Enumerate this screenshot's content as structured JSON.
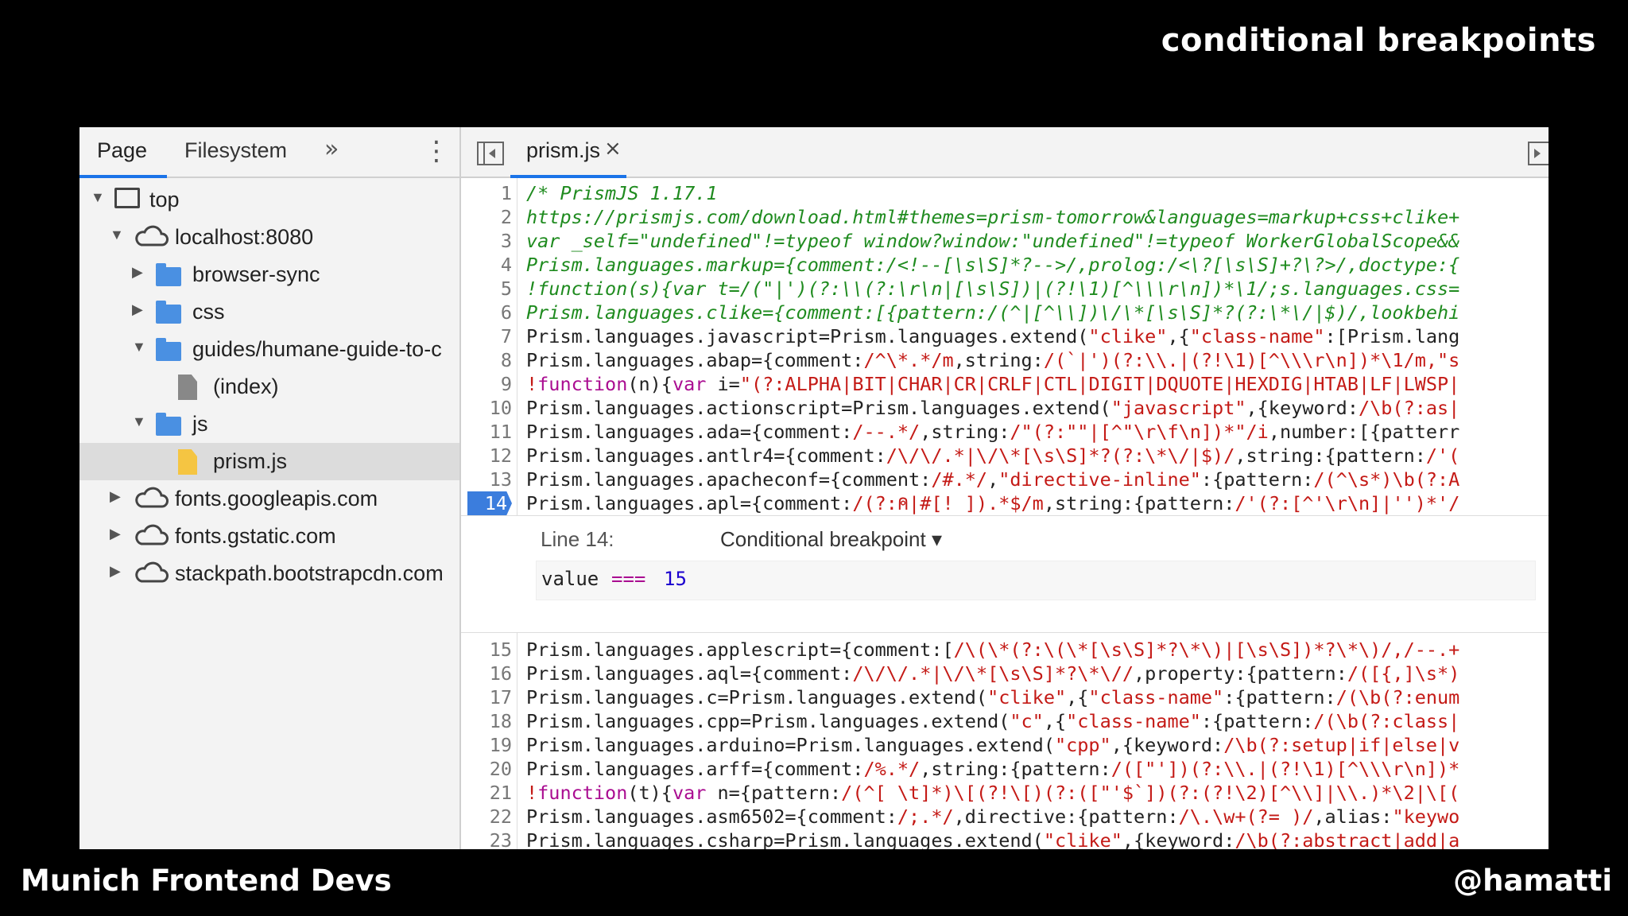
{
  "slide": {
    "title": "conditional breakpoints",
    "footer_left": "Munich Frontend Devs",
    "footer_right": "@hamatti"
  },
  "navigator": {
    "tabs": [
      "Page",
      "Filesystem"
    ],
    "more": "»",
    "menu": "⋮",
    "tree": [
      {
        "label": "top",
        "icon": "frame-icon",
        "arrow": "▼",
        "indent": 0
      },
      {
        "label": "localhost:8080",
        "icon": "cloud-icon",
        "arrow": "▼",
        "indent": 1
      },
      {
        "label": "browser-sync",
        "icon": "folder-icon",
        "arrow": "▶",
        "indent": 2
      },
      {
        "label": "css",
        "icon": "folder-icon",
        "arrow": "▶",
        "indent": 2
      },
      {
        "label": "guides/humane-guide-to-c",
        "icon": "folder-icon",
        "arrow": "▼",
        "indent": 2
      },
      {
        "label": "(index)",
        "icon": "file-icon",
        "arrow": "",
        "indent": 3
      },
      {
        "label": "js",
        "icon": "folder-icon",
        "arrow": "▼",
        "indent": 2
      },
      {
        "label": "prism.js",
        "icon": "js-file-icon",
        "arrow": "",
        "indent": 3
      },
      {
        "label": "fonts.googleapis.com",
        "icon": "cloud-icon",
        "arrow": "▶",
        "indent": 1
      },
      {
        "label": "fonts.gstatic.com",
        "icon": "cloud-icon",
        "arrow": "▶",
        "indent": 1
      },
      {
        "label": "stackpath.bootstrapcdn.com",
        "icon": "cloud-icon",
        "arrow": "▶",
        "indent": 1
      }
    ]
  },
  "editor": {
    "file_tab": "prism.js",
    "close": "×",
    "breakpoint_line": "14",
    "breakpoint_editor": {
      "title": "Line 14:",
      "type": "Conditional breakpoint ▾",
      "condition": [
        "value",
        "===",
        "15"
      ]
    },
    "lines_before": [
      {
        "n": "1",
        "t": [
          [
            "c",
            "/* PrismJS 1.17.1"
          ]
        ]
      },
      {
        "n": "2",
        "t": [
          [
            "c",
            "https://prismjs.com/download.html#themes=prism-tomorrow&languages=markup+css+clike+"
          ]
        ]
      },
      {
        "n": "3",
        "t": [
          [
            "c",
            "var _self=\"undefined\"!=typeof window?window:\"undefined\"!=typeof WorkerGlobalScope&&"
          ]
        ]
      },
      {
        "n": "4",
        "t": [
          [
            "c",
            "Prism.languages.markup={comment:/<!--[\\s\\S]*?-->/,prolog:/<\\?[\\s\\S]+?\\?>/,doctype:{"
          ]
        ]
      },
      {
        "n": "5",
        "t": [
          [
            "c",
            "!function(s){var t=/(\"|')(?:\\\\(?:\\r\\n|[\\s\\S])|(?!\\1)[^\\\\\\r\\n])*\\1/;s.languages.css="
          ]
        ]
      },
      {
        "n": "6",
        "t": [
          [
            "c",
            "Prism.languages.clike={comment:[{pattern:/(^|[^\\\\])\\/\\*[\\s\\S]*?(?:\\*\\/|$)/,lookbehi"
          ]
        ]
      },
      {
        "n": "7",
        "t": [
          [
            "p",
            "Prism.languages.javascript=Prism.languages.extend("
          ],
          [
            "s",
            "\"clike\""
          ],
          [
            "p",
            ",{"
          ],
          [
            "s",
            "\"class-name\""
          ],
          [
            "p",
            ":[Prism.lang"
          ]
        ]
      },
      {
        "n": "8",
        "t": [
          [
            "p",
            "Prism.languages.abap={comment:"
          ],
          [
            "s",
            "/^\\*.*/m"
          ],
          [
            "p",
            ",string:"
          ],
          [
            "s",
            "/(`|')(?:\\\\.|(?!\\1)[^\\\\\\r\\n])*\\1/m,\"s"
          ]
        ]
      },
      {
        "n": "9",
        "t": [
          [
            "s",
            "!"
          ],
          [
            "k",
            "function"
          ],
          [
            "p",
            "(n){"
          ],
          [
            "k",
            "var"
          ],
          [
            "p",
            " i="
          ],
          [
            "s",
            "\"(?:ALPHA|BIT|CHAR|CR|CRLF|CTL|DIGIT|DQUOTE|HEXDIG|HTAB|LF|LWSP|"
          ]
        ]
      },
      {
        "n": "10",
        "t": [
          [
            "p",
            "Prism.languages.actionscript=Prism.languages.extend("
          ],
          [
            "s",
            "\"javascript\""
          ],
          [
            "p",
            ",{keyword:"
          ],
          [
            "s",
            "/\\b(?:as|"
          ]
        ]
      },
      {
        "n": "11",
        "t": [
          [
            "p",
            "Prism.languages.ada={comment:"
          ],
          [
            "s",
            "/--.*/"
          ],
          [
            "p",
            ",string:"
          ],
          [
            "s",
            "/\"(?:\"\"|[^\"\\r\\f\\n])*\"/i"
          ],
          [
            "p",
            ",number:[{patterr"
          ]
        ]
      },
      {
        "n": "12",
        "t": [
          [
            "p",
            "Prism.languages.antlr4={comment:"
          ],
          [
            "s",
            "/\\/\\/.*|\\/\\*[\\s\\S]*?(?:\\*\\/|$)/"
          ],
          [
            "p",
            ",string:{pattern:"
          ],
          [
            "s",
            "/'("
          ]
        ]
      },
      {
        "n": "13",
        "t": [
          [
            "p",
            "Prism.languages.apacheconf={comment:"
          ],
          [
            "s",
            "/#.*/"
          ],
          [
            "p",
            ","
          ],
          [
            "s",
            "\"directive-inline\""
          ],
          [
            "p",
            ":{pattern:"
          ],
          [
            "s",
            "/(^\\s*)\\b(?:A"
          ]
        ]
      },
      {
        "n": "14",
        "t": [
          [
            "p",
            "Prism.languages.apl={comment:"
          ],
          [
            "s",
            "/(?:⍝|#[! ]).*$/m"
          ],
          [
            "p",
            ",string:{pattern:"
          ],
          [
            "s",
            "/'(?:[^'\\r\\n]|'')*'/"
          ]
        ]
      }
    ],
    "lines_after": [
      {
        "n": "15",
        "t": [
          [
            "p",
            "Prism.languages.applescript={comment:["
          ],
          [
            "s",
            "/\\(\\*(?:\\(\\*[\\s\\S]*?\\*\\)|[\\s\\S])*?\\*\\)/,/--.+"
          ]
        ]
      },
      {
        "n": "16",
        "t": [
          [
            "p",
            "Prism.languages.aql={comment:"
          ],
          [
            "s",
            "/\\/\\/.*|\\/\\*[\\s\\S]*?\\*\\//"
          ],
          [
            "p",
            ",property:{pattern:"
          ],
          [
            "s",
            "/([{,]\\s*)"
          ]
        ]
      },
      {
        "n": "17",
        "t": [
          [
            "p",
            "Prism.languages.c=Prism.languages.extend("
          ],
          [
            "s",
            "\"clike\""
          ],
          [
            "p",
            ",{"
          ],
          [
            "s",
            "\"class-name\""
          ],
          [
            "p",
            ":{pattern:"
          ],
          [
            "s",
            "/(\\b(?:enum"
          ]
        ]
      },
      {
        "n": "18",
        "t": [
          [
            "p",
            "Prism.languages.cpp=Prism.languages.extend("
          ],
          [
            "s",
            "\"c\""
          ],
          [
            "p",
            ",{"
          ],
          [
            "s",
            "\"class-name\""
          ],
          [
            "p",
            ":{pattern:"
          ],
          [
            "s",
            "/(\\b(?:class|"
          ]
        ]
      },
      {
        "n": "19",
        "t": [
          [
            "p",
            "Prism.languages.arduino=Prism.languages.extend("
          ],
          [
            "s",
            "\"cpp\""
          ],
          [
            "p",
            ",{keyword:"
          ],
          [
            "s",
            "/\\b(?:setup|if|else|v"
          ]
        ]
      },
      {
        "n": "20",
        "t": [
          [
            "p",
            "Prism.languages.arff={comment:"
          ],
          [
            "s",
            "/%.*/"
          ],
          [
            "p",
            ",string:{pattern:"
          ],
          [
            "s",
            "/([\"'])(?:\\\\.|(?!\\1)[^\\\\\\r\\n])*"
          ]
        ]
      },
      {
        "n": "21",
        "t": [
          [
            "s",
            "!"
          ],
          [
            "k",
            "function"
          ],
          [
            "p",
            "(t){"
          ],
          [
            "k",
            "var"
          ],
          [
            "p",
            " n={pattern:"
          ],
          [
            "s",
            "/(^[ \\t]*)\\[(?!\\[)(?:([\"'$`])(?:(?!\\2)[^\\\\]|\\\\.)*\\2|\\[("
          ]
        ]
      },
      {
        "n": "22",
        "t": [
          [
            "p",
            "Prism.languages.asm6502={comment:"
          ],
          [
            "s",
            "/;.*/"
          ],
          [
            "p",
            ",directive:{pattern:"
          ],
          [
            "s",
            "/\\.\\w+(?= )/"
          ],
          [
            "p",
            ",alias:"
          ],
          [
            "s",
            "\"keywo"
          ]
        ]
      },
      {
        "n": "23",
        "t": [
          [
            "p",
            "Prism.languages.csharp=Prism.languages.extend("
          ],
          [
            "s",
            "\"clike\""
          ],
          [
            "p",
            ",{keyword:"
          ],
          [
            "s",
            "/\\b(?:abstract|add|a"
          ]
        ]
      }
    ]
  },
  "colors": {
    "accent": "#1a73e8",
    "breakpoint": "#3b7ddd",
    "comment": "#1f8b1f",
    "string": "#c41a16"
  }
}
